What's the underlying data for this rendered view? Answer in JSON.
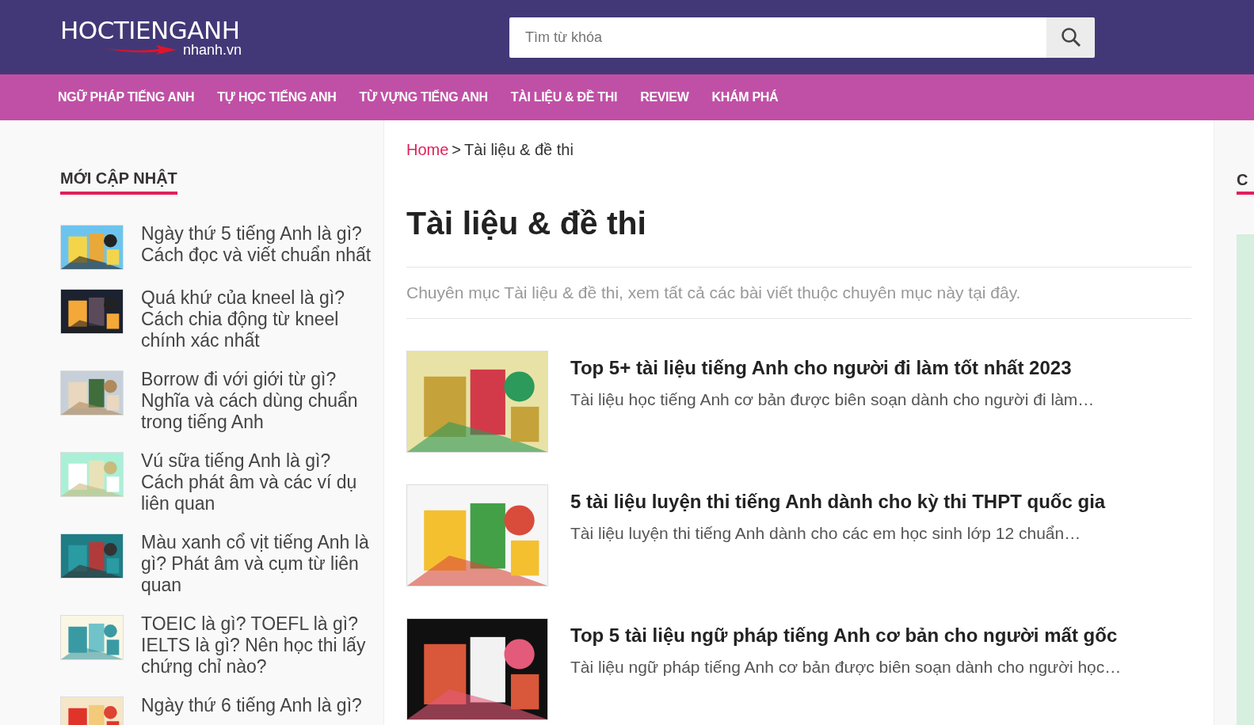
{
  "header": {
    "logo": {
      "title": "HOCTIENGANH",
      "subtitle": "nhanh.vn"
    },
    "search": {
      "placeholder": "Tìm từ khóa"
    }
  },
  "nav": {
    "items": [
      {
        "label": "NGỮ PHÁP TIẾNG ANH"
      },
      {
        "label": "TỰ HỌC TIẾNG ANH"
      },
      {
        "label": "TỪ VỰNG TIẾNG ANH"
      },
      {
        "label": "TÀI LIỆU & ĐỀ THI"
      },
      {
        "label": "REVIEW"
      },
      {
        "label": "KHÁM PHÁ"
      }
    ]
  },
  "sidebar": {
    "heading": "MỚI CẬP NHẬT",
    "items": [
      {
        "title": "Ngày thứ 5 tiếng Anh là gì? Cách đọc và viết chuẩn nhất"
      },
      {
        "title": "Quá khứ của kneel là gì? Cách chia động từ kneel chính xác nhất"
      },
      {
        "title": "Borrow đi với giới từ gì? Nghĩa và cách dùng chuẩn trong tiếng Anh"
      },
      {
        "title": "Vú sữa tiếng Anh là gì? Cách phát âm và các ví dụ liên quan"
      },
      {
        "title": "Màu xanh cổ vịt tiếng Anh là gì? Phát âm và cụm từ liên quan"
      },
      {
        "title": "TOEIC là gì? TOEFL là gì? IELTS là gì? Nên học thi lấy chứng chỉ nào?"
      },
      {
        "title": "Ngày thứ 6 tiếng Anh là gì?"
      }
    ]
  },
  "main": {
    "breadcrumb": {
      "home": "Home",
      "separator": ">",
      "current": "Tài liệu & đề thi"
    },
    "title": "Tài liệu & đề thi",
    "description": "Chuyên mục Tài liệu & đề thi, xem tất cả các bài viết thuộc chuyên mục này tại đây.",
    "posts": [
      {
        "title": "Top 5+ tài liệu tiếng Anh cho người đi làm tốt nhất 2023",
        "excerpt": "Tài liệu học tiếng Anh cơ bản được biên soạn dành cho người đi làm…"
      },
      {
        "title": "5 tài liệu luyện thi tiếng Anh dành cho kỳ thi THPT quốc gia",
        "excerpt": "Tài liệu luyện thi tiếng Anh dành cho các em học sinh lớp 12 chuẩn…"
      },
      {
        "title": "Top 5 tài liệu ngữ pháp tiếng Anh cơ bản cho người mất gốc",
        "excerpt": "Tài liệu ngữ pháp tiếng Anh cơ bản được biên soạn dành cho người học…"
      }
    ]
  },
  "right_sidebar": {
    "heading": "C"
  }
}
